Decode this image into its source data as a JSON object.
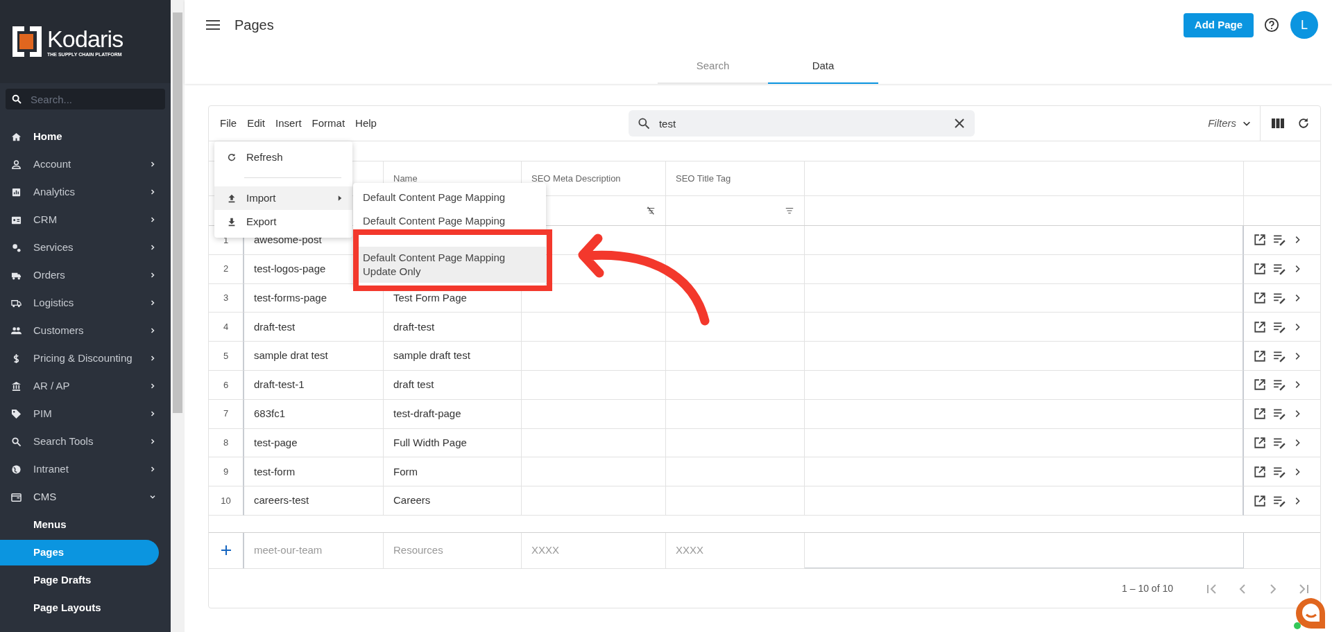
{
  "sidebar": {
    "logo": {
      "name": "Kodaris",
      "tagline": "THE SUPPLY CHAIN PLATFORM"
    },
    "search": {
      "placeholder": "Search..."
    },
    "items": [
      {
        "label": "Home"
      },
      {
        "label": "Account",
        "expanded": false
      },
      {
        "label": "Analytics",
        "expanded": false
      },
      {
        "label": "CRM",
        "expanded": false
      },
      {
        "label": "Services",
        "expanded": false
      },
      {
        "label": "Orders",
        "expanded": false
      },
      {
        "label": "Logistics",
        "expanded": false
      },
      {
        "label": "Customers",
        "expanded": false
      },
      {
        "label": "Pricing & Discounting",
        "expanded": false
      },
      {
        "label": "AR / AP",
        "expanded": false
      },
      {
        "label": "PIM",
        "expanded": false
      },
      {
        "label": "Search Tools",
        "expanded": false
      },
      {
        "label": "Intranet",
        "expanded": false
      },
      {
        "label": "CMS",
        "expanded": true,
        "children": [
          {
            "label": "Menus",
            "selected": false
          },
          {
            "label": "Pages",
            "selected": true
          },
          {
            "label": "Page Drafts",
            "selected": false
          },
          {
            "label": "Page Layouts",
            "selected": false
          }
        ]
      }
    ]
  },
  "header": {
    "title": "Pages",
    "add_button": "Add Page",
    "avatar": "L"
  },
  "tabs": [
    {
      "label": "Search",
      "selected": false
    },
    {
      "label": "Data",
      "selected": true
    }
  ],
  "grid": {
    "menu": [
      "File",
      "Edit",
      "Insert",
      "Format",
      "Help"
    ],
    "search": {
      "value": "test"
    },
    "filters": "Filters",
    "columns": [
      "Name",
      "SEO Meta Description",
      "SEO Title Tag"
    ],
    "rows": [
      {
        "index": "1",
        "column_1": "awesome-post"
      },
      {
        "index": "2",
        "column_1": "test-logos-page"
      },
      {
        "index": "3",
        "column_1": "test-forms-page",
        "name": "Test Form Page"
      },
      {
        "index": "4",
        "column_1": "draft-test",
        "name": "draft-test"
      },
      {
        "index": "5",
        "column_1": "sample drat test",
        "name": "sample draft test"
      },
      {
        "index": "6",
        "column_1": "draft-test-1",
        "name": "draft test"
      },
      {
        "index": "7",
        "column_1": "683fc1",
        "name": "test-draft-page"
      },
      {
        "index": "8",
        "column_1": "test-page",
        "name": "Full Width Page"
      },
      {
        "index": "9",
        "column_1": "test-form",
        "name": "Form"
      },
      {
        "index": "10",
        "column_1": "careers-test",
        "name": "Careers"
      }
    ],
    "new_row": [
      "meet-our-team",
      "Resources",
      "XXXX",
      "XXXX"
    ],
    "pagination": "1 – 10 of 10"
  },
  "file_menu": {
    "items": [
      {
        "label": "Refresh",
        "kind": "action",
        "highlighted": false
      },
      {
        "label": "Import",
        "kind": "submenu",
        "highlighted": true
      },
      {
        "label": "Export",
        "kind": "action",
        "highlighted": false
      }
    ],
    "submenu": [
      {
        "label": "Default Content Page Mapping",
        "highlighted": false
      },
      {
        "label": "Default Content Page Mapping",
        "highlighted": false
      },
      {
        "label": "Default Content Page Mapping Update Only",
        "highlighted": true
      }
    ]
  },
  "annotation": {
    "box": true,
    "arrow": true
  }
}
